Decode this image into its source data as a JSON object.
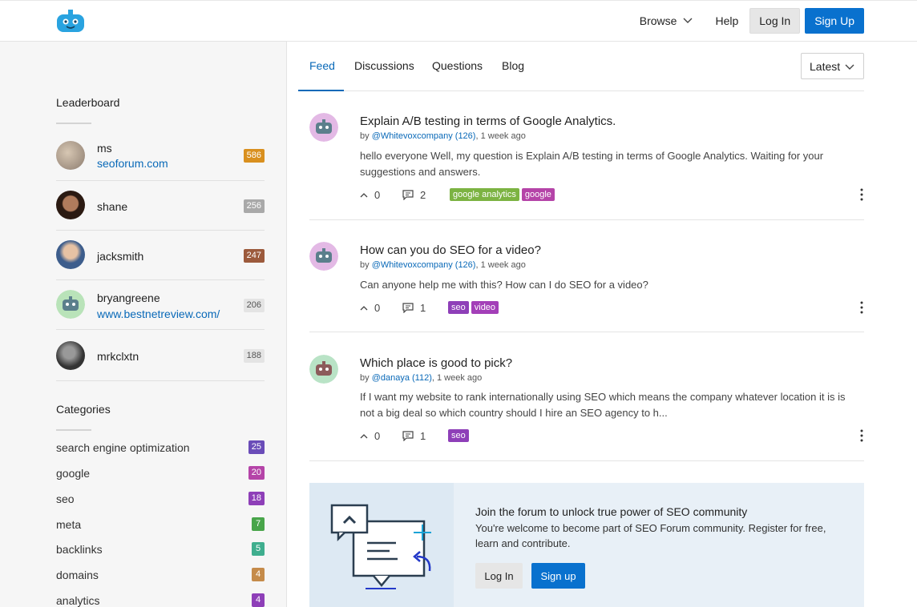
{
  "header": {
    "browse_label": "Browse",
    "help_label": "Help",
    "login_label": "Log In",
    "signup_label": "Sign Up"
  },
  "sidebar": {
    "leaderboard_title": "Leaderboard",
    "leaderboard": [
      {
        "name": "ms",
        "link": "seoforum.com",
        "score": "586",
        "color": "#d9901f"
      },
      {
        "name": "shane",
        "link": "",
        "score": "256",
        "color": "#a9a9a9"
      },
      {
        "name": "jacksmith",
        "link": "",
        "score": "247",
        "color": "#9c5a3c"
      },
      {
        "name": "bryangreene",
        "link": "www.bestnetreview.com/",
        "score": "206",
        "color": "#e4e4e4"
      },
      {
        "name": "mrkclxtn",
        "link": "",
        "score": "188",
        "color": "#e4e4e4"
      }
    ],
    "categories_title": "Categories",
    "categories": [
      {
        "name": "search engine optimization",
        "count": "25",
        "color": "#6a4cb8"
      },
      {
        "name": "google",
        "count": "20",
        "color": "#b544a8"
      },
      {
        "name": "seo",
        "count": "18",
        "color": "#8e3fb8"
      },
      {
        "name": "meta",
        "count": "7",
        "color": "#48a54a"
      },
      {
        "name": "backlinks",
        "count": "5",
        "color": "#3fae8e"
      },
      {
        "name": "domains",
        "count": "4",
        "color": "#c58b4a"
      },
      {
        "name": "analytics",
        "count": "4",
        "color": "#8e3fb8"
      }
    ]
  },
  "tabs": [
    {
      "label": "Feed"
    },
    {
      "label": "Discussions"
    },
    {
      "label": "Questions"
    },
    {
      "label": "Blog"
    }
  ],
  "sort_label": "Latest",
  "posts": [
    {
      "title": "Explain A/B testing in terms of Google Analytics.",
      "by": "by ",
      "user": "@Whitevoxcompany (126)",
      "time": ", 1 week ago",
      "body": "hello everyone Well, my question is Explain A/B testing in terms of Google Analytics. Waiting for your suggestions and answers.",
      "votes": "0",
      "comments": "2",
      "tags": [
        {
          "name": "google analytics",
          "color": "#7cb342"
        },
        {
          "name": "google",
          "color": "#b544a8"
        }
      ]
    },
    {
      "title": "How can you do SEO for a video?",
      "by": "by ",
      "user": "@Whitevoxcompany (126)",
      "time": ", 1 week ago",
      "body": "Can anyone help me with this? How can I do SEO for a video?",
      "votes": "0",
      "comments": "1",
      "tags": [
        {
          "name": "seo",
          "color": "#8e3fb8"
        },
        {
          "name": "video",
          "color": "#a33fb8"
        }
      ]
    },
    {
      "title": "Which place is good to pick?",
      "by": "by ",
      "user": "@danaya (112)",
      "time": ", 1 week ago",
      "body": "If I want my website to rank internationally using SEO which means the company whatever location it is is not a big deal so which country should I hire an SEO agency to h...",
      "votes": "0",
      "comments": "1",
      "tags": [
        {
          "name": "seo",
          "color": "#8e3fb8"
        }
      ]
    }
  ],
  "banner": {
    "title": "Join the forum to unlock true power of SEO community",
    "text": "You're welcome to become part of SEO Forum community. Register for free, learn and contribute.",
    "login_label": "Log In",
    "signup_label": "Sign up"
  }
}
